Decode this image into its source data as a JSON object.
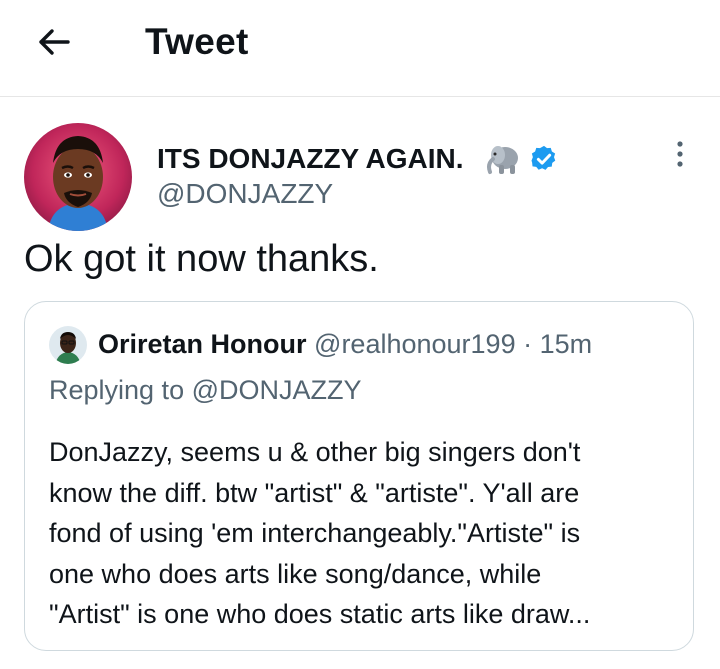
{
  "header": {
    "title": "Tweet"
  },
  "tweet": {
    "author": {
      "name": "ITS DONJAZZY AGAIN.",
      "handle": "@DONJAZZY",
      "emoji": "🐘",
      "verified": true
    },
    "text": "Ok got it now thanks."
  },
  "quoted": {
    "author": {
      "name": "Oriretan Honour",
      "handle": "@realhonour199",
      "separator": "·",
      "time": "15m"
    },
    "replying_to": "Replying to @DONJAZZY",
    "body": "DonJazzy, seems u & other big singers don't\nknow the diff. btw \"artist\" & \"artiste\". Y'all are\nfond of using 'em interchangeably.\"Artiste\" is\none who does arts like song/dance, while\n\"Artist\" is one who does static arts like draw..."
  },
  "colors": {
    "verified": "#1d9bf0",
    "secondary_text": "#536471",
    "primary_text": "#0f1419",
    "border": "#cfd9de"
  }
}
